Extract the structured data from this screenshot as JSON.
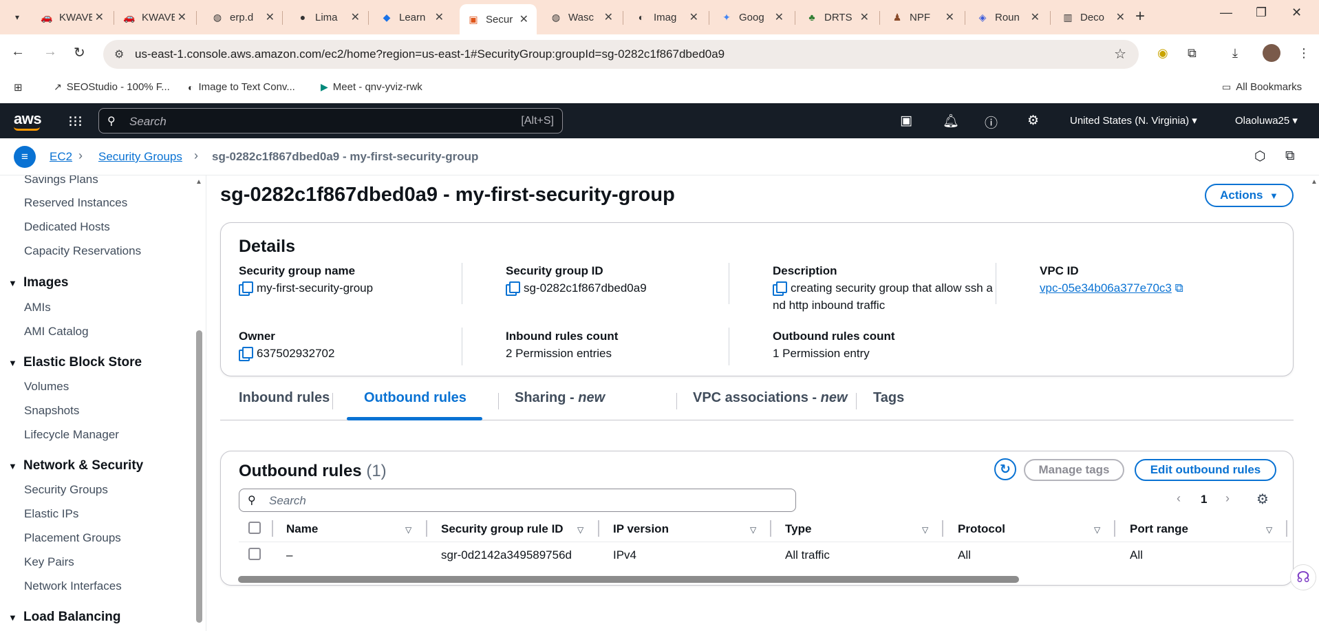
{
  "browser": {
    "tabs": [
      {
        "title": "KWAVE",
        "icon": "car-icon"
      },
      {
        "title": "KWAVE",
        "icon": "car-icon"
      },
      {
        "title": "erp.d",
        "icon": "globe-icon"
      },
      {
        "title": "Lima",
        "icon": "github-icon"
      },
      {
        "title": "Learn",
        "icon": "learn-icon"
      },
      {
        "title": "Secur",
        "icon": "aws-icon"
      },
      {
        "title": "Wasc",
        "icon": "globe-icon"
      },
      {
        "title": "Imag",
        "icon": "image-icon"
      },
      {
        "title": "Goog",
        "icon": "gemini-icon"
      },
      {
        "title": "DRTS",
        "icon": "tree-icon"
      },
      {
        "title": "NPF",
        "icon": "npf-icon"
      },
      {
        "title": "Roun",
        "icon": "cube-icon"
      },
      {
        "title": "Deco",
        "icon": "deco-icon"
      }
    ],
    "active_tab_index": 5,
    "url": "us-east-1.console.aws.amazon.com/ec2/home?region=us-east-1#SecurityGroup:groupId=sg-0282c1f867dbed0a9",
    "bookmarks": [
      {
        "label": "SEOStudio - 100% F...",
        "icon": "seo-icon"
      },
      {
        "label": "Image to Text Conv...",
        "icon": "image-icon"
      },
      {
        "label": "Meet - qnv-yviz-rwk",
        "icon": "meet-icon"
      }
    ],
    "all_bookmarks_label": "All Bookmarks"
  },
  "aws": {
    "logo": "aws",
    "search_placeholder": "Search",
    "search_hint": "[Alt+S]",
    "region": "United States (N. Virginia)",
    "user": "Olaoluwa25"
  },
  "breadcrumb": {
    "items": [
      "EC2",
      "Security Groups"
    ],
    "current": "sg-0282c1f867dbed0a9 - my-first-security-group"
  },
  "sidebar": {
    "top_items": [
      "Savings Plans",
      "Reserved Instances",
      "Dedicated Hosts",
      "Capacity Reservations"
    ],
    "sections": [
      {
        "title": "Images",
        "items": [
          "AMIs",
          "AMI Catalog"
        ]
      },
      {
        "title": "Elastic Block Store",
        "items": [
          "Volumes",
          "Snapshots",
          "Lifecycle Manager"
        ]
      },
      {
        "title": "Network & Security",
        "items": [
          "Security Groups",
          "Elastic IPs",
          "Placement Groups",
          "Key Pairs",
          "Network Interfaces"
        ]
      },
      {
        "title": "Load Balancing",
        "items": []
      }
    ]
  },
  "page": {
    "title": "sg-0282c1f867dbed0a9 - my-first-security-group",
    "actions_label": "Actions"
  },
  "details": {
    "title": "Details",
    "sg_name_label": "Security group name",
    "sg_name": "my-first-security-group",
    "sg_id_label": "Security group ID",
    "sg_id": "sg-0282c1f867dbed0a9",
    "description_label": "Description",
    "description_line1": "creating security group that allow ssh a",
    "description_line2": "nd http inbound traffic",
    "vpc_label": "VPC ID",
    "vpc_id": "vpc-05e34b06a377e70c3",
    "owner_label": "Owner",
    "owner": "637502932702",
    "inbound_count_label": "Inbound rules count",
    "inbound_count": "2 Permission entries",
    "outbound_count_label": "Outbound rules count",
    "outbound_count": "1 Permission entry"
  },
  "tabs": {
    "inbound": "Inbound rules",
    "outbound": "Outbound rules",
    "sharing": "Sharing - ",
    "sharing_new": "new",
    "vpc_assoc": "VPC associations - ",
    "vpc_assoc_new": "new",
    "tags": "Tags"
  },
  "outbound": {
    "title": "Outbound rules",
    "count": "(1)",
    "manage_tags": "Manage tags",
    "edit_label": "Edit outbound rules",
    "search_placeholder": "Search",
    "page": "1",
    "columns": [
      "Name",
      "Security group rule ID",
      "IP version",
      "Type",
      "Protocol",
      "Port range"
    ],
    "rows": [
      {
        "name": "–",
        "rule_id": "sgr-0d2142a349589756d",
        "ip_version": "IPv4",
        "type": "All traffic",
        "protocol": "All",
        "port_range": "All"
      }
    ]
  },
  "colors": {
    "aws_header": "#161d26",
    "accent_blue": "#0972d3",
    "aws_orange": "#ff9900",
    "chrome_tabstrip": "#fbe3d6"
  }
}
